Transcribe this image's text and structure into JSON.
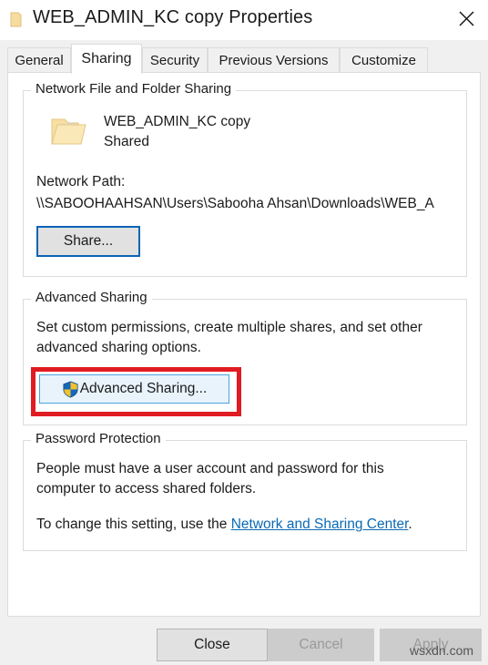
{
  "window": {
    "title": "WEB_ADMIN_KC copy Properties",
    "icon": "folder-icon",
    "close_label": "✕"
  },
  "tabs": [
    {
      "label": "General",
      "active": false
    },
    {
      "label": "Sharing",
      "active": true
    },
    {
      "label": "Security",
      "active": false
    },
    {
      "label": "Previous Versions",
      "active": false
    },
    {
      "label": "Customize",
      "active": false
    }
  ],
  "network_sharing": {
    "group_title": "Network File and Folder Sharing",
    "folder_icon": "folder-icon",
    "folder_name": "WEB_ADMIN_KC copy",
    "share_status": "Shared",
    "network_path_label": "Network Path:",
    "network_path_value": "\\\\SABOOHAAHSAN\\Users\\Sabooha Ahsan\\Downloads\\WEB_A",
    "share_button": "Share..."
  },
  "advanced_sharing": {
    "group_title": "Advanced Sharing",
    "description_line1": "Set custom permissions, create multiple shares, and set other",
    "description_line2": "advanced sharing options.",
    "button_label": "Advanced Sharing...",
    "button_icon": "uac-shield-icon",
    "highlight_color": "#e01b22"
  },
  "password_protection": {
    "group_title": "Password Protection",
    "description_line1": "People must have a user account and password for this",
    "description_line2": "computer to access shared folders.",
    "change_prefix": "To change this setting, use the ",
    "link_text": "Network and Sharing Center",
    "change_suffix": "."
  },
  "footer": {
    "close_label": "Close",
    "cancel_label": "Cancel",
    "apply_label": "Apply"
  },
  "watermark": "wsxdn.com",
  "colors": {
    "accent_blue": "#0b63b5",
    "link_blue": "#0a6ab5",
    "highlight_red": "#e01b22",
    "folder_yellow": "#f8d885",
    "dialog_bg": "#f0f0f0",
    "panel_bg": "#ffffff"
  }
}
